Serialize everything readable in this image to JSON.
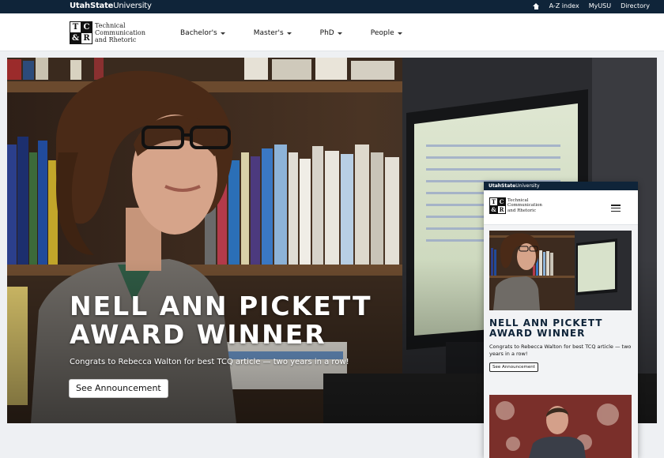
{
  "university": {
    "bold": "UtahState",
    "light": "University"
  },
  "utility_nav": [
    {
      "label": "A-Z index"
    },
    {
      "label": "MyUSU"
    },
    {
      "label": "Directory"
    }
  ],
  "logo": {
    "letters": [
      "T",
      "C",
      "&",
      "R"
    ],
    "lines": [
      "Technical",
      "Communication",
      "and Rhetoric"
    ]
  },
  "nav": [
    {
      "label": "Bachelor's"
    },
    {
      "label": "Master's"
    },
    {
      "label": "PhD"
    },
    {
      "label": "People"
    }
  ],
  "hero": {
    "title_line1": "NELL ANN PICKETT",
    "title_line2": "AWARD WINNER",
    "subtitle": "Congrats to Rebecca Walton for best TCQ article — two years in a row!",
    "button_label": "See Announcement"
  },
  "mobile": {
    "title_line1": "NELL ANN PICKETT",
    "title_line2": "AWARD WINNER",
    "subtitle": "Congrats to Rebecca Walton for best TCQ article — two years in a row!",
    "button_label": "See Announcement"
  },
  "colors": {
    "navy": "#0f2439",
    "white": "#ffffff",
    "page_bg": "#eef0f3"
  },
  "icons": [
    "home-icon",
    "chevron-down-icon",
    "hamburger-menu-icon"
  ]
}
